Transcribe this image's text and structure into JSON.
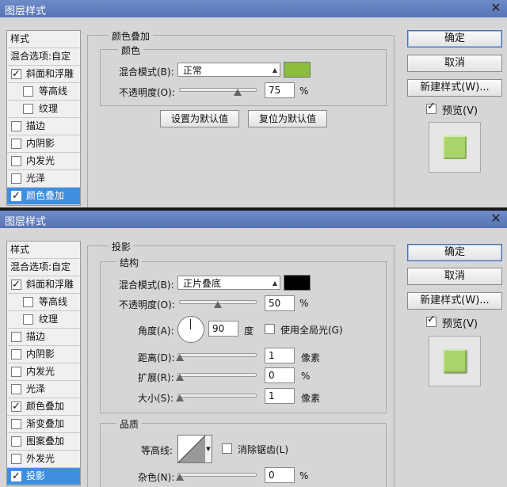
{
  "top": {
    "title": "图层样式",
    "close": "✕",
    "list": [
      {
        "label": "样式",
        "type": "header"
      },
      {
        "label": "混合选项:自定",
        "type": "header"
      },
      {
        "label": "斜面和浮雕",
        "checked": true,
        "indent": 0
      },
      {
        "label": "等高线",
        "checked": false,
        "indent": 1
      },
      {
        "label": "纹理",
        "checked": false,
        "indent": 1
      },
      {
        "label": "描边",
        "checked": false,
        "indent": 0
      },
      {
        "label": "内阴影",
        "checked": false,
        "indent": 0
      },
      {
        "label": "内发光",
        "checked": false,
        "indent": 0
      },
      {
        "label": "光泽",
        "checked": false,
        "indent": 0
      },
      {
        "label": "颜色叠加",
        "checked": true,
        "indent": 0,
        "selected": true
      }
    ],
    "panel_title": "颜色叠加",
    "group_title": "颜色",
    "blend_label": "混合模式(B):",
    "blend_value": "正常",
    "opacity_label": "不透明度(O):",
    "opacity_value": "75",
    "pct": "%",
    "set_default": "设置为默认值",
    "reset_default": "复位为默认值",
    "ok": "确定",
    "cancel": "取消",
    "new_style": "新建样式(W)...",
    "preview": "预览(V)",
    "preview_checked": true
  },
  "bottom": {
    "title": "图层样式",
    "close": "✕",
    "list": [
      {
        "label": "样式",
        "type": "header"
      },
      {
        "label": "混合选项:自定",
        "type": "header"
      },
      {
        "label": "斜面和浮雕",
        "checked": true,
        "indent": 0
      },
      {
        "label": "等高线",
        "checked": false,
        "indent": 1
      },
      {
        "label": "纹理",
        "checked": false,
        "indent": 1
      },
      {
        "label": "描边",
        "checked": false,
        "indent": 0
      },
      {
        "label": "内阴影",
        "checked": false,
        "indent": 0
      },
      {
        "label": "内发光",
        "checked": false,
        "indent": 0
      },
      {
        "label": "光泽",
        "checked": false,
        "indent": 0
      },
      {
        "label": "颜色叠加",
        "checked": true,
        "indent": 0
      },
      {
        "label": "渐变叠加",
        "checked": false,
        "indent": 0
      },
      {
        "label": "图案叠加",
        "checked": false,
        "indent": 0
      },
      {
        "label": "外发光",
        "checked": false,
        "indent": 0
      },
      {
        "label": "投影",
        "checked": true,
        "indent": 0,
        "selected": true
      }
    ],
    "panel_title": "投影",
    "structure_title": "结构",
    "blend_label": "混合模式(B):",
    "blend_value": "正片叠底",
    "opacity_label": "不透明度(O):",
    "opacity_value": "50",
    "angle_label": "角度(A):",
    "angle_value": "90",
    "angle_unit": "度",
    "global_light": "使用全局光(G)",
    "distance_label": "距离(D):",
    "distance_value": "1",
    "spread_label": "扩展(R):",
    "spread_value": "0",
    "size_label": "大小(S):",
    "size_value": "1",
    "px": "像素",
    "pct": "%",
    "quality_title": "品质",
    "contour_label": "等高线:",
    "antialias": "消除锯齿(L)",
    "noise_label": "杂色(N):",
    "noise_value": "0",
    "ok": "确定",
    "cancel": "取消",
    "new_style": "新建样式(W)...",
    "preview": "预览(V)",
    "preview_checked": true
  },
  "colors": {
    "overlay": "#8cbc3c",
    "shadow": "#000000",
    "preview_fill": "#a8d46a"
  }
}
